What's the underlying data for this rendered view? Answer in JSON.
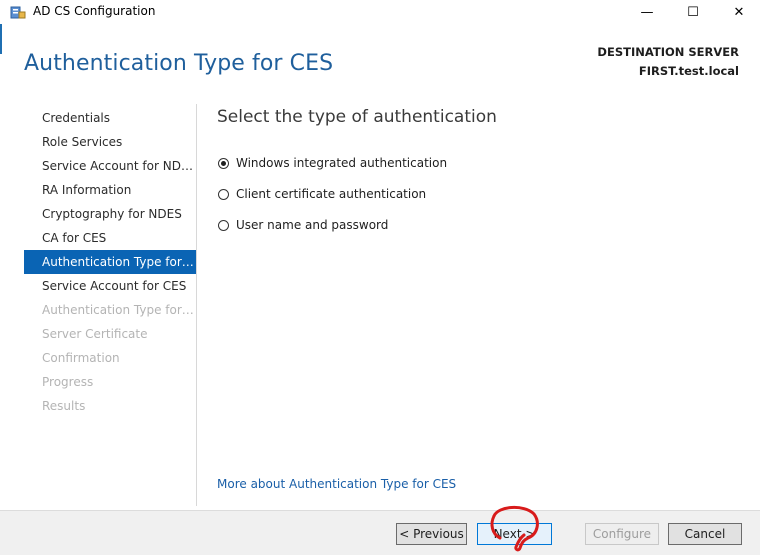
{
  "window": {
    "title": "AD CS Configuration",
    "controls": {
      "minimize": "—",
      "maximize": "☐",
      "close": "✕"
    }
  },
  "header": {
    "title": "Authentication Type for CES",
    "destination_label": "DESTINATION SERVER",
    "destination_server": "FIRST.test.local"
  },
  "sidebar": {
    "items": [
      {
        "label": "Credentials",
        "state": "normal"
      },
      {
        "label": "Role Services",
        "state": "normal"
      },
      {
        "label": "Service Account for NDES",
        "state": "normal"
      },
      {
        "label": "RA Information",
        "state": "normal"
      },
      {
        "label": "Cryptography for NDES",
        "state": "normal"
      },
      {
        "label": "CA for CES",
        "state": "normal"
      },
      {
        "label": "Authentication Type for C...",
        "state": "active"
      },
      {
        "label": "Service Account for CES",
        "state": "normal"
      },
      {
        "label": "Authentication Type for C...",
        "state": "disabled"
      },
      {
        "label": "Server Certificate",
        "state": "disabled"
      },
      {
        "label": "Confirmation",
        "state": "disabled"
      },
      {
        "label": "Progress",
        "state": "disabled"
      },
      {
        "label": "Results",
        "state": "disabled"
      }
    ]
  },
  "main": {
    "section_title": "Select the type of authentication",
    "options": [
      {
        "label": "Windows integrated authentication",
        "checked": true
      },
      {
        "label": "Client certificate authentication",
        "checked": false
      },
      {
        "label": "User name and password",
        "checked": false
      }
    ],
    "more_link": "More about Authentication Type for CES"
  },
  "footer": {
    "previous": "< Previous",
    "next": "Next >",
    "configure": "Configure",
    "cancel": "Cancel"
  },
  "colors": {
    "accent": "#0a64b4",
    "title": "#1f5f9c",
    "link": "#1a5fa8",
    "annotation": "#d81b1b"
  }
}
